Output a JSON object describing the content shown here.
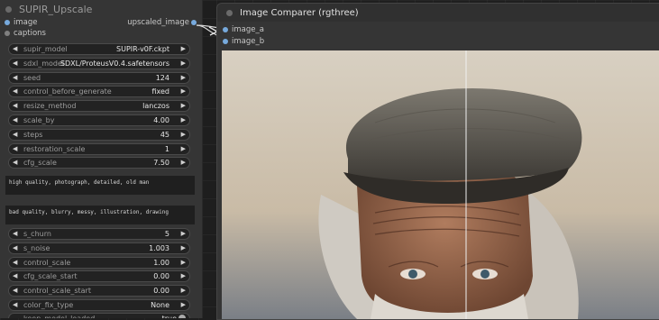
{
  "left_node": {
    "title": "SUPIR_Upscale",
    "inputs": [
      {
        "name": "image"
      },
      {
        "name": "captions"
      }
    ],
    "outputs": [
      {
        "name": "upscaled_image"
      }
    ],
    "widgets": [
      {
        "name": "supir_model",
        "value": "SUPIR-v0F.ckpt"
      },
      {
        "name": "sdxl_model",
        "value": "SDXL/ProteusV0.4.safetensors"
      },
      {
        "name": "seed",
        "value": "124"
      },
      {
        "name": "control_before_generate",
        "value": "fixed"
      },
      {
        "name": "resize_method",
        "value": "lanczos"
      },
      {
        "name": "scale_by",
        "value": "4.00"
      },
      {
        "name": "steps",
        "value": "45"
      },
      {
        "name": "restoration_scale",
        "value": "1"
      },
      {
        "name": "cfg_scale",
        "value": "7.50"
      }
    ],
    "positive_prompt": "high quality, photograph, detailed, old man",
    "negative_prompt": "bad quality, blurry, messy, illustration, drawing",
    "widgets2": [
      {
        "name": "s_churn",
        "value": "5"
      },
      {
        "name": "s_noise",
        "value": "1.003"
      },
      {
        "name": "control_scale",
        "value": "1.00"
      },
      {
        "name": "cfg_scale_start",
        "value": "0.00"
      },
      {
        "name": "control_scale_start",
        "value": "0.00"
      },
      {
        "name": "color_fix_type",
        "value": "None"
      }
    ],
    "partial_row": {
      "name": "keep_model_loaded",
      "value": "true"
    }
  },
  "right_node": {
    "title": "Image Comparer (rgthree)",
    "inputs": [
      {
        "name": "image_a"
      },
      {
        "name": "image_b"
      }
    ]
  },
  "colors": {
    "link": "#77aadd",
    "canvas": "#1e1e1e",
    "node_bg": "#353535"
  }
}
